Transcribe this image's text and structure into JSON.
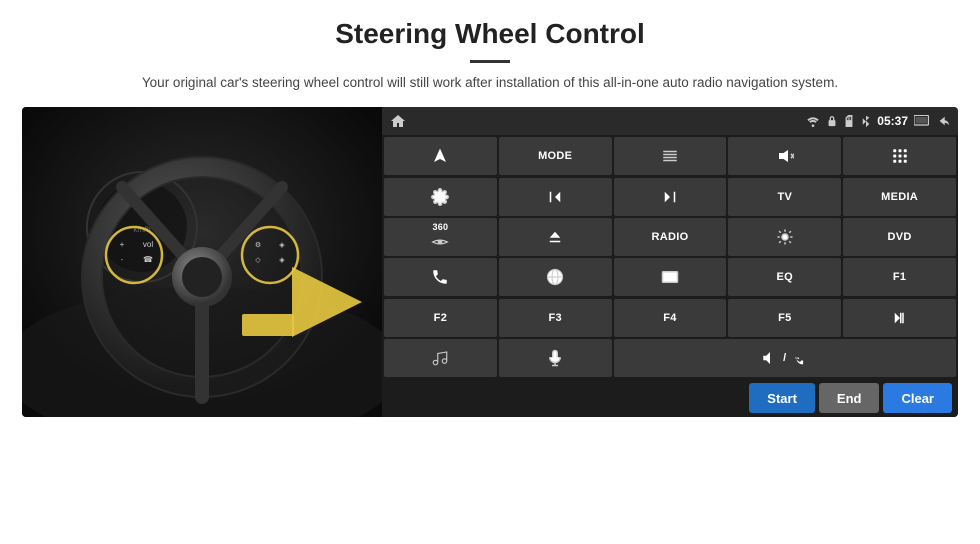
{
  "page": {
    "title": "Steering Wheel Control",
    "subtitle": "Your original car's steering wheel control will still work after installation of this all-in-one auto radio navigation system.",
    "divider_color": "#333"
  },
  "status_bar": {
    "time": "05:37",
    "wifi_icon": "wifi",
    "lock_icon": "lock",
    "card_icon": "sd-card",
    "bt_icon": "bluetooth",
    "screen_icon": "screen",
    "back_icon": "back"
  },
  "buttons": [
    {
      "id": "home",
      "type": "icon",
      "icon": "home",
      "label": "Home"
    },
    {
      "id": "mode",
      "type": "text",
      "label": "MODE"
    },
    {
      "id": "list",
      "type": "icon",
      "icon": "list",
      "label": "List"
    },
    {
      "id": "mute",
      "type": "icon",
      "icon": "mute",
      "label": "Mute"
    },
    {
      "id": "apps",
      "type": "icon",
      "icon": "apps",
      "label": "Apps"
    },
    {
      "id": "settings",
      "type": "icon",
      "icon": "settings",
      "label": "Settings"
    },
    {
      "id": "prev",
      "type": "icon",
      "icon": "prev",
      "label": "Previous"
    },
    {
      "id": "next",
      "type": "icon",
      "icon": "next",
      "label": "Next"
    },
    {
      "id": "tv",
      "type": "text",
      "label": "TV"
    },
    {
      "id": "media",
      "type": "text",
      "label": "MEDIA"
    },
    {
      "id": "cam360",
      "type": "icon",
      "icon": "360",
      "label": "360 Camera"
    },
    {
      "id": "eject",
      "type": "icon",
      "icon": "eject",
      "label": "Eject"
    },
    {
      "id": "radio",
      "type": "text",
      "label": "RADIO"
    },
    {
      "id": "bright",
      "type": "icon",
      "icon": "sun",
      "label": "Brightness"
    },
    {
      "id": "dvd",
      "type": "text",
      "label": "DVD"
    },
    {
      "id": "phone",
      "type": "icon",
      "icon": "phone",
      "label": "Phone"
    },
    {
      "id": "browse",
      "type": "icon",
      "icon": "browse",
      "label": "Browse"
    },
    {
      "id": "window",
      "type": "icon",
      "icon": "window",
      "label": "Window"
    },
    {
      "id": "eq",
      "type": "text",
      "label": "EQ"
    },
    {
      "id": "f1",
      "type": "text",
      "label": "F1"
    },
    {
      "id": "f2",
      "type": "text",
      "label": "F2"
    },
    {
      "id": "f3",
      "type": "text",
      "label": "F3"
    },
    {
      "id": "f4",
      "type": "text",
      "label": "F4"
    },
    {
      "id": "f5",
      "type": "text",
      "label": "F5"
    },
    {
      "id": "playpause",
      "type": "icon",
      "icon": "play",
      "label": "Play/Pause"
    },
    {
      "id": "music",
      "type": "icon",
      "icon": "music",
      "label": "Music"
    },
    {
      "id": "mic",
      "type": "icon",
      "icon": "mic",
      "label": "Microphone"
    },
    {
      "id": "vol",
      "type": "icon",
      "icon": "vol",
      "label": "Volume"
    }
  ],
  "bottom_controls": {
    "start_label": "Start",
    "end_label": "End",
    "clear_label": "Clear"
  }
}
